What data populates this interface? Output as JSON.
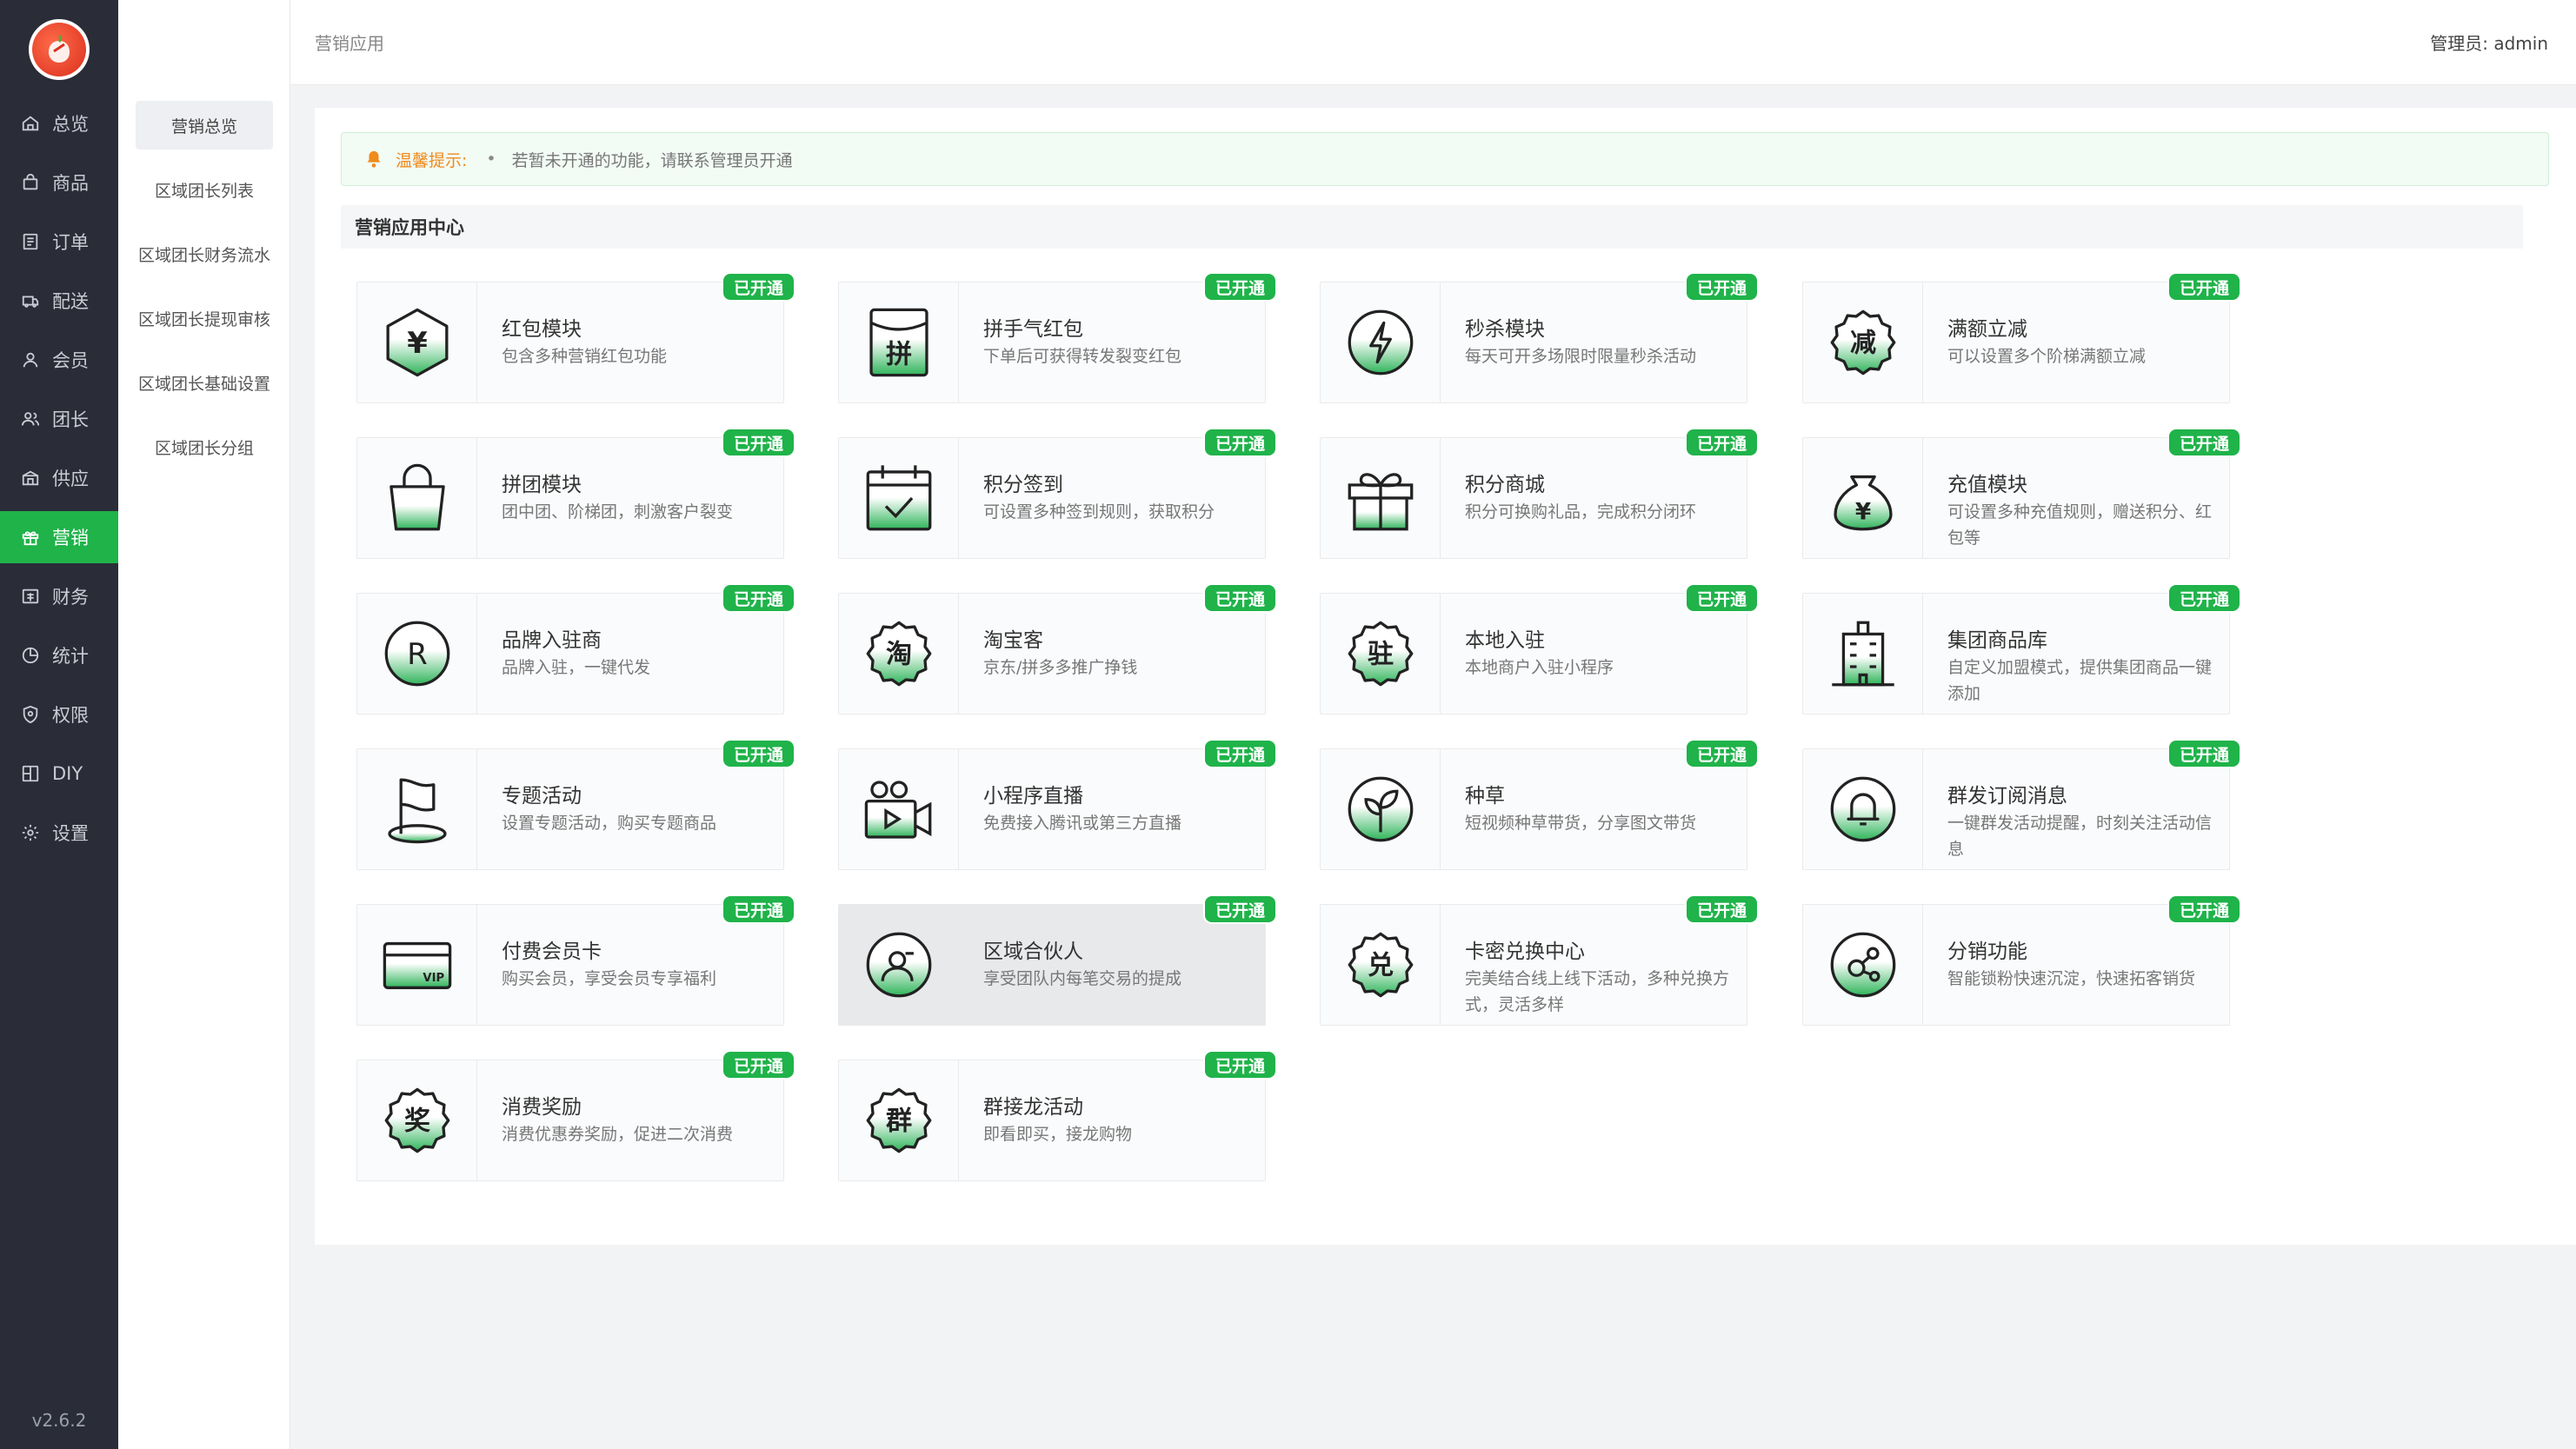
{
  "app": {
    "version": "v2.6.2"
  },
  "sidebar": {
    "items": [
      {
        "label": "总览",
        "icon": "home-icon"
      },
      {
        "label": "商品",
        "icon": "shopping-bag-icon"
      },
      {
        "label": "订单",
        "icon": "order-list-icon"
      },
      {
        "label": "配送",
        "icon": "delivery-icon"
      },
      {
        "label": "会员",
        "icon": "user-icon"
      },
      {
        "label": "团长",
        "icon": "team-leader-icon"
      },
      {
        "label": "供应",
        "icon": "supply-icon"
      },
      {
        "label": "营销",
        "icon": "gift-icon",
        "active": true
      },
      {
        "label": "财务",
        "icon": "finance-icon"
      },
      {
        "label": "统计",
        "icon": "chart-pie-icon"
      },
      {
        "label": "权限",
        "icon": "shield-icon"
      },
      {
        "label": "DIY",
        "icon": "layout-icon"
      },
      {
        "label": "设置",
        "icon": "gear-icon"
      }
    ]
  },
  "subnav": {
    "items": [
      {
        "label": "营销总览",
        "active": true
      },
      {
        "label": "区域团长列表"
      },
      {
        "label": "区域团长财务流水"
      },
      {
        "label": "区域团长提现审核"
      },
      {
        "label": "区域团长基础设置"
      },
      {
        "label": "区域团长分组"
      }
    ]
  },
  "header": {
    "breadcrumb": "营销应用",
    "admin": "管理员:  admin"
  },
  "notice": {
    "title": "温馨提示:",
    "bullet": "•",
    "message": "若暂未开通的功能，请联系管理员开通"
  },
  "section": {
    "title": "营销应用中心"
  },
  "badge_label": "已开通",
  "colors": {
    "accent": "#1fb34a",
    "sidebar": "#2a2d38",
    "warning": "#f08a1c"
  },
  "apps": [
    {
      "name": "红包模块",
      "desc": "包含多种营销红包功能",
      "icon": "red-packet-icon"
    },
    {
      "name": "拼手气红包",
      "desc": "下单后可获得转发裂变红包",
      "icon": "lucky-packet-icon"
    },
    {
      "name": "秒杀模块",
      "desc": "每天可开多场限时限量秒杀活动",
      "icon": "lightning-icon"
    },
    {
      "name": "满额立减",
      "desc": "可以设置多个阶梯满额立减",
      "icon": "discount-icon"
    },
    {
      "name": "拼团模块",
      "desc": "团中团、阶梯团，刺激客户裂变",
      "icon": "shopping-bag-icon"
    },
    {
      "name": "积分签到",
      "desc": "可设置多种签到规则，获取积分",
      "icon": "calendar-check-icon"
    },
    {
      "name": "积分商城",
      "desc": "积分可换购礼品，完成积分闭环",
      "icon": "gift-box-icon"
    },
    {
      "name": "充值模块",
      "desc": "可设置多种充值规则，赠送积分、红包等",
      "icon": "money-bag-icon"
    },
    {
      "name": "品牌入驻商",
      "desc": "品牌入驻，一键代发",
      "icon": "registered-icon"
    },
    {
      "name": "淘宝客",
      "desc": "京东/拼多多推广挣钱",
      "icon": "taobao-icon"
    },
    {
      "name": "本地入驻",
      "desc": "本地商户入驻小程序",
      "icon": "local-store-icon"
    },
    {
      "name": "集团商品库",
      "desc": "自定义加盟模式，提供集团商品一键添加",
      "icon": "building-icon"
    },
    {
      "name": "专题活动",
      "desc": "设置专题活动，购买专题商品",
      "icon": "flag-icon"
    },
    {
      "name": "小程序直播",
      "desc": "免费接入腾讯或第三方直播",
      "icon": "live-camera-icon"
    },
    {
      "name": "种草",
      "desc": "短视频种草带货，分享图文带货",
      "icon": "sprout-icon"
    },
    {
      "name": "群发订阅消息",
      "desc": "一键群发活动提醒，时刻关注活动信息",
      "icon": "bell-icon"
    },
    {
      "name": "付费会员卡",
      "desc": "购买会员，享受会员专享福利",
      "icon": "vip-card-icon"
    },
    {
      "name": "区域合伙人",
      "desc": "享受团队内每笔交易的提成",
      "icon": "partner-icon",
      "hover": true
    },
    {
      "name": "卡密兑换中心",
      "desc": "完美结合线上线下活动，多种兑换方式，灵活多样",
      "icon": "exchange-icon"
    },
    {
      "name": "分销功能",
      "desc": "智能锁粉快速沉淀，快速拓客销货",
      "icon": "distribution-icon"
    },
    {
      "name": "消费奖励",
      "desc": "消费优惠券奖励，促进二次消费",
      "icon": "reward-icon"
    },
    {
      "name": "群接龙活动",
      "desc": "即看即买，接龙购物",
      "icon": "group-chain-icon"
    }
  ]
}
